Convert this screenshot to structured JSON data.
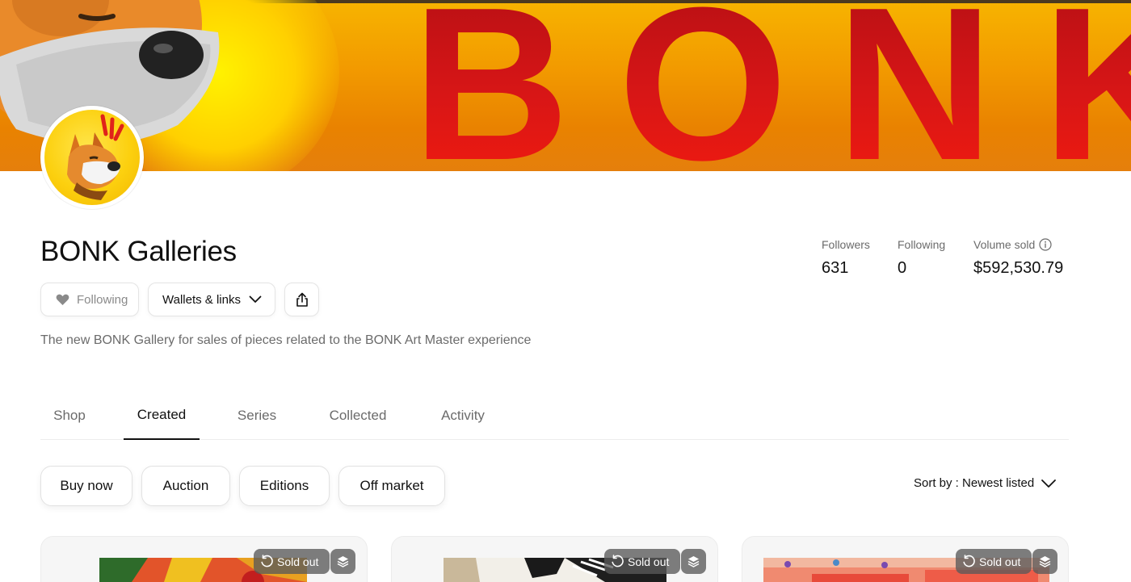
{
  "banner": {
    "word": "BONK"
  },
  "profile": {
    "name": "BONK Galleries",
    "following_button": "Following",
    "wallets_button": "Wallets & links",
    "bio": "The new BONK Gallery for sales of pieces related to the BONK Art Master experience"
  },
  "stats": {
    "followers_label": "Followers",
    "followers_value": "631",
    "following_label": "Following",
    "following_value": "0",
    "volume_label": "Volume sold",
    "volume_value": "$592,530.79"
  },
  "tabs": [
    {
      "label": "Shop"
    },
    {
      "label": "Created"
    },
    {
      "label": "Series"
    },
    {
      "label": "Collected"
    },
    {
      "label": "Activity"
    }
  ],
  "active_tab": "Created",
  "filters": [
    {
      "label": "Buy now"
    },
    {
      "label": "Auction"
    },
    {
      "label": "Editions"
    },
    {
      "label": "Off market"
    }
  ],
  "sort": {
    "label": "Sort by : Newest listed"
  },
  "cards": [
    {
      "badge": "Sold out"
    },
    {
      "badge": "Sold out"
    },
    {
      "badge": "Sold out"
    }
  ],
  "icons": {
    "heart": "heart-icon",
    "chevron": "chevron-down-icon",
    "share": "share-icon",
    "info": "info-icon",
    "sold_out": "refresh-icon",
    "stack": "layers-icon"
  },
  "colors": {
    "banner_orange": "#f29a00",
    "banner_red": "#d81616",
    "avatar_yellow": "#fcd00f",
    "text_muted": "#6b6b6b"
  }
}
